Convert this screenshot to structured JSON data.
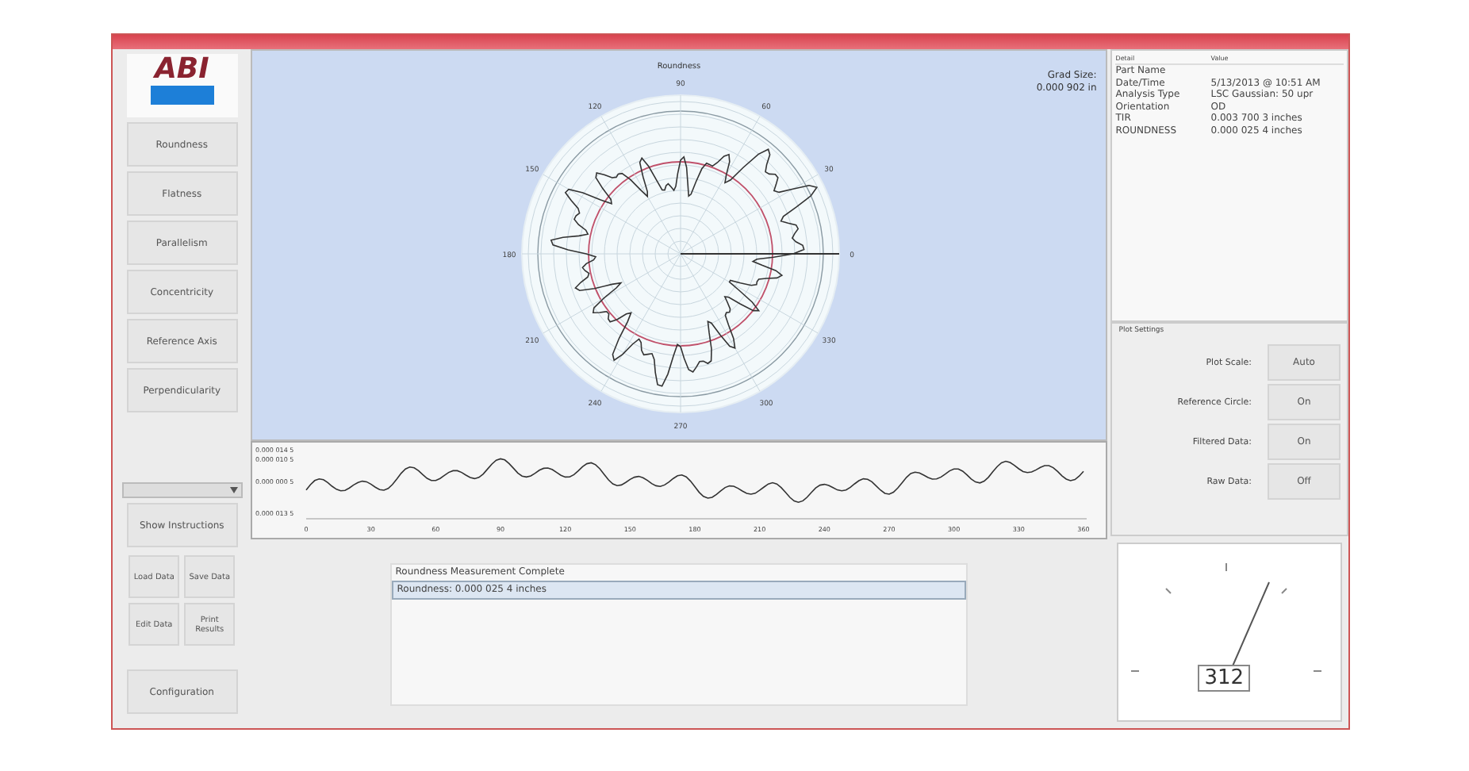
{
  "sidebar": {
    "logo": "ABI",
    "nav_buttons": [
      "Roundness",
      "Flatness",
      "Parallelism",
      "Concentricity",
      "Reference Axis",
      "Perpendicularity"
    ],
    "show_instructions": "Show Instructions",
    "small_buttons": [
      "Load Data",
      "Save Data",
      "Edit Data",
      "Print Results"
    ],
    "configuration": "Configuration"
  },
  "polar_plot": {
    "title": "Roundness",
    "grad_size_label": "Grad Size:",
    "grad_size_value": "0.000 902 in",
    "angle_labels": [
      "0",
      "30",
      "60",
      "90",
      "120",
      "150",
      "180",
      "210",
      "240",
      "270",
      "300",
      "330"
    ]
  },
  "profile_plot": {
    "y_ticks": [
      "0.000 014 5",
      "0.000 010 5",
      "0.000 000 5",
      "0.000 013 5"
    ],
    "x_ticks": [
      "0",
      "30",
      "60",
      "90",
      "120",
      "150",
      "180",
      "210",
      "240",
      "270",
      "300",
      "330",
      "360"
    ]
  },
  "messages": [
    {
      "text": "Roundness Measurement Complete",
      "selected": false
    },
    {
      "text": "Roundness: 0.000 025 4 inches",
      "selected": true
    }
  ],
  "details": {
    "columns": [
      "Detail",
      "Value"
    ],
    "rows": [
      [
        "Part Name",
        ""
      ],
      [
        "Date/Time",
        "5/13/2013 @ 10:51 AM"
      ],
      [
        "Analysis Type",
        "LSC Gaussian: 50 upr"
      ],
      [
        "Orientation",
        "OD"
      ],
      [
        "TIR",
        "0.003 700 3 inches"
      ],
      [
        "ROUNDNESS",
        "0.000 025 4 inches"
      ]
    ]
  },
  "plot_settings": {
    "title": "Plot Settings",
    "rows": [
      {
        "label": "Plot Scale:",
        "value": "Auto"
      },
      {
        "label": "Reference Circle:",
        "value": "On"
      },
      {
        "label": "Filtered Data:",
        "value": "On"
      },
      {
        "label": "Raw Data:",
        "value": "Off"
      }
    ]
  },
  "gauge": {
    "reading": "312"
  }
}
